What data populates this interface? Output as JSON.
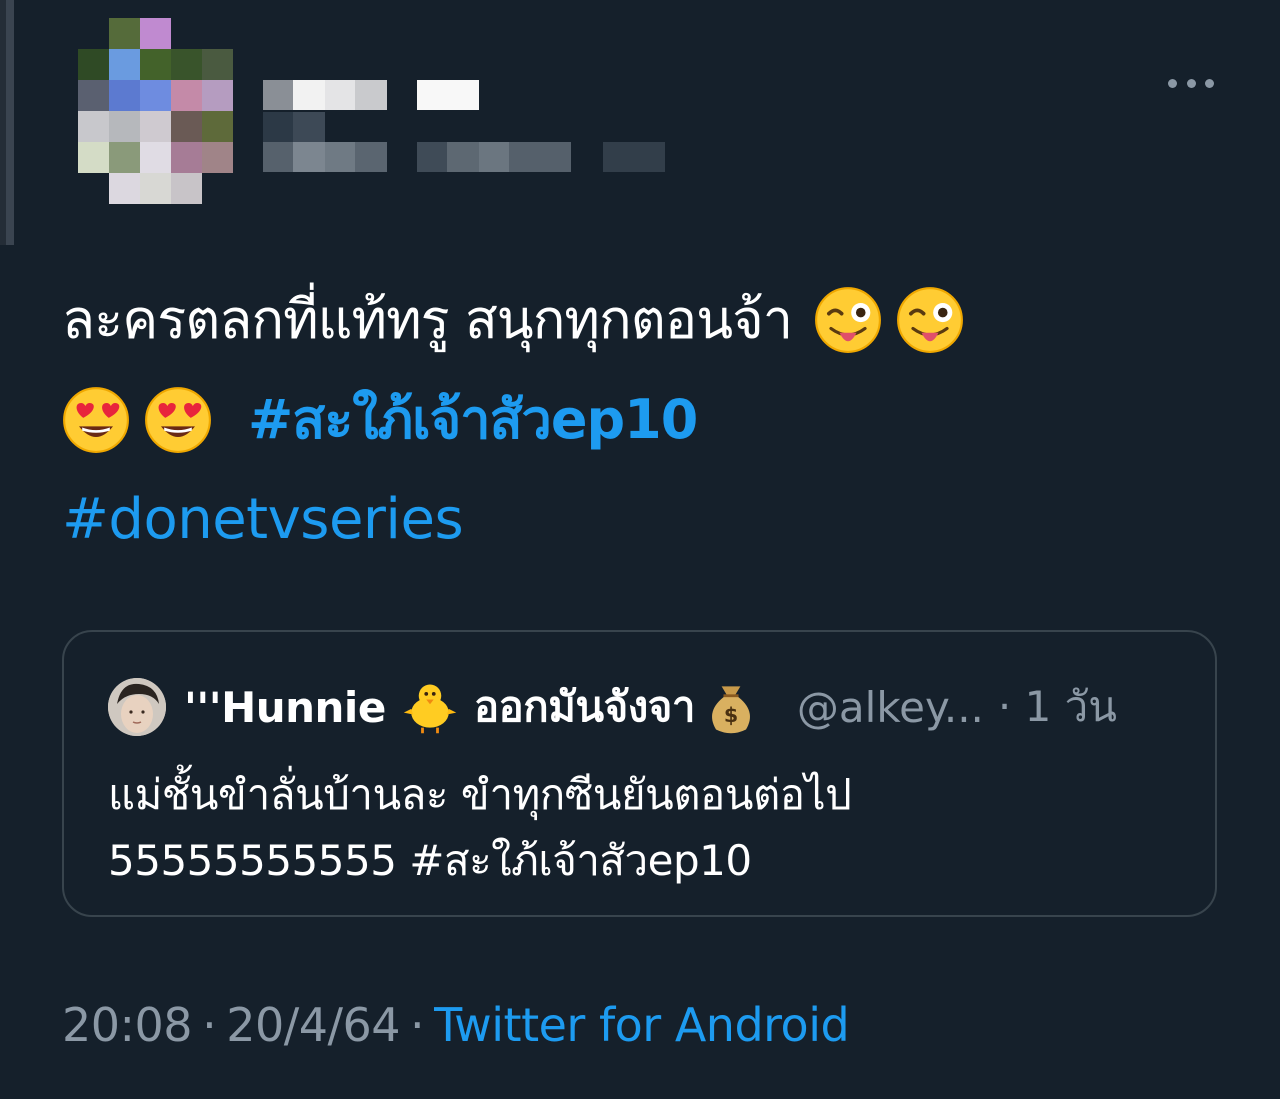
{
  "tweet": {
    "text_main": "ละครตลกที่แท้ทรู สนุกทุกตอนจ้า",
    "hashtags": [
      "#สะใภ้เจ้าสัวep10",
      "#donetvseries"
    ],
    "emojis_line1": [
      "winking-tongue-emoji",
      "winking-tongue-emoji"
    ],
    "emojis_line2": [
      "heart-eyes-emoji",
      "heart-eyes-emoji"
    ],
    "time": "20:08",
    "date": "20/4/64",
    "source": "Twitter for Android",
    "separator": "·"
  },
  "quoted_tweet": {
    "name": "'''Hunnie",
    "name_suffix": "ออกมันจังจา",
    "name_emojis": [
      "chick-emoji",
      "money-bag-emoji"
    ],
    "handle": "@alkey...",
    "time": "· 1 วัน",
    "body_line1": "แม่ชั้นขำลั่นบ้านละ ขำทุกซีนยันตอนต่อไป",
    "body_line2": "55555555555 #สะใภ้เจ้าสัวep10"
  },
  "colors": {
    "background": "#15202b",
    "link": "#1d9bf0",
    "muted": "#8b98a5",
    "border": "#38444d"
  },
  "icons": {
    "more": "more-dots-icon"
  }
}
